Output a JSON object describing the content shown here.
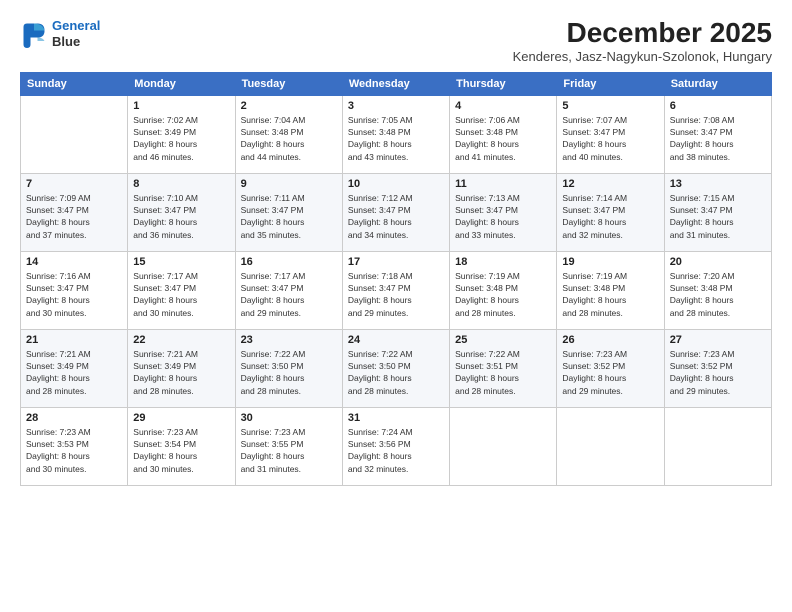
{
  "logo": {
    "line1": "General",
    "line2": "Blue"
  },
  "title": "December 2025",
  "subtitle": "Kenderes, Jasz-Nagykun-Szolonok, Hungary",
  "headers": [
    "Sunday",
    "Monday",
    "Tuesday",
    "Wednesday",
    "Thursday",
    "Friday",
    "Saturday"
  ],
  "weeks": [
    [
      {
        "day": "",
        "info": ""
      },
      {
        "day": "1",
        "info": "Sunrise: 7:02 AM\nSunset: 3:49 PM\nDaylight: 8 hours\nand 46 minutes."
      },
      {
        "day": "2",
        "info": "Sunrise: 7:04 AM\nSunset: 3:48 PM\nDaylight: 8 hours\nand 44 minutes."
      },
      {
        "day": "3",
        "info": "Sunrise: 7:05 AM\nSunset: 3:48 PM\nDaylight: 8 hours\nand 43 minutes."
      },
      {
        "day": "4",
        "info": "Sunrise: 7:06 AM\nSunset: 3:48 PM\nDaylight: 8 hours\nand 41 minutes."
      },
      {
        "day": "5",
        "info": "Sunrise: 7:07 AM\nSunset: 3:47 PM\nDaylight: 8 hours\nand 40 minutes."
      },
      {
        "day": "6",
        "info": "Sunrise: 7:08 AM\nSunset: 3:47 PM\nDaylight: 8 hours\nand 38 minutes."
      }
    ],
    [
      {
        "day": "7",
        "info": "Sunrise: 7:09 AM\nSunset: 3:47 PM\nDaylight: 8 hours\nand 37 minutes."
      },
      {
        "day": "8",
        "info": "Sunrise: 7:10 AM\nSunset: 3:47 PM\nDaylight: 8 hours\nand 36 minutes."
      },
      {
        "day": "9",
        "info": "Sunrise: 7:11 AM\nSunset: 3:47 PM\nDaylight: 8 hours\nand 35 minutes."
      },
      {
        "day": "10",
        "info": "Sunrise: 7:12 AM\nSunset: 3:47 PM\nDaylight: 8 hours\nand 34 minutes."
      },
      {
        "day": "11",
        "info": "Sunrise: 7:13 AM\nSunset: 3:47 PM\nDaylight: 8 hours\nand 33 minutes."
      },
      {
        "day": "12",
        "info": "Sunrise: 7:14 AM\nSunset: 3:47 PM\nDaylight: 8 hours\nand 32 minutes."
      },
      {
        "day": "13",
        "info": "Sunrise: 7:15 AM\nSunset: 3:47 PM\nDaylight: 8 hours\nand 31 minutes."
      }
    ],
    [
      {
        "day": "14",
        "info": "Sunrise: 7:16 AM\nSunset: 3:47 PM\nDaylight: 8 hours\nand 30 minutes."
      },
      {
        "day": "15",
        "info": "Sunrise: 7:17 AM\nSunset: 3:47 PM\nDaylight: 8 hours\nand 30 minutes."
      },
      {
        "day": "16",
        "info": "Sunrise: 7:17 AM\nSunset: 3:47 PM\nDaylight: 8 hours\nand 29 minutes."
      },
      {
        "day": "17",
        "info": "Sunrise: 7:18 AM\nSunset: 3:47 PM\nDaylight: 8 hours\nand 29 minutes."
      },
      {
        "day": "18",
        "info": "Sunrise: 7:19 AM\nSunset: 3:48 PM\nDaylight: 8 hours\nand 28 minutes."
      },
      {
        "day": "19",
        "info": "Sunrise: 7:19 AM\nSunset: 3:48 PM\nDaylight: 8 hours\nand 28 minutes."
      },
      {
        "day": "20",
        "info": "Sunrise: 7:20 AM\nSunset: 3:48 PM\nDaylight: 8 hours\nand 28 minutes."
      }
    ],
    [
      {
        "day": "21",
        "info": "Sunrise: 7:21 AM\nSunset: 3:49 PM\nDaylight: 8 hours\nand 28 minutes."
      },
      {
        "day": "22",
        "info": "Sunrise: 7:21 AM\nSunset: 3:49 PM\nDaylight: 8 hours\nand 28 minutes."
      },
      {
        "day": "23",
        "info": "Sunrise: 7:22 AM\nSunset: 3:50 PM\nDaylight: 8 hours\nand 28 minutes."
      },
      {
        "day": "24",
        "info": "Sunrise: 7:22 AM\nSunset: 3:50 PM\nDaylight: 8 hours\nand 28 minutes."
      },
      {
        "day": "25",
        "info": "Sunrise: 7:22 AM\nSunset: 3:51 PM\nDaylight: 8 hours\nand 28 minutes."
      },
      {
        "day": "26",
        "info": "Sunrise: 7:23 AM\nSunset: 3:52 PM\nDaylight: 8 hours\nand 29 minutes."
      },
      {
        "day": "27",
        "info": "Sunrise: 7:23 AM\nSunset: 3:52 PM\nDaylight: 8 hours\nand 29 minutes."
      }
    ],
    [
      {
        "day": "28",
        "info": "Sunrise: 7:23 AM\nSunset: 3:53 PM\nDaylight: 8 hours\nand 30 minutes."
      },
      {
        "day": "29",
        "info": "Sunrise: 7:23 AM\nSunset: 3:54 PM\nDaylight: 8 hours\nand 30 minutes."
      },
      {
        "day": "30",
        "info": "Sunrise: 7:23 AM\nSunset: 3:55 PM\nDaylight: 8 hours\nand 31 minutes."
      },
      {
        "day": "31",
        "info": "Sunrise: 7:24 AM\nSunset: 3:56 PM\nDaylight: 8 hours\nand 32 minutes."
      },
      {
        "day": "",
        "info": ""
      },
      {
        "day": "",
        "info": ""
      },
      {
        "day": "",
        "info": ""
      }
    ]
  ]
}
